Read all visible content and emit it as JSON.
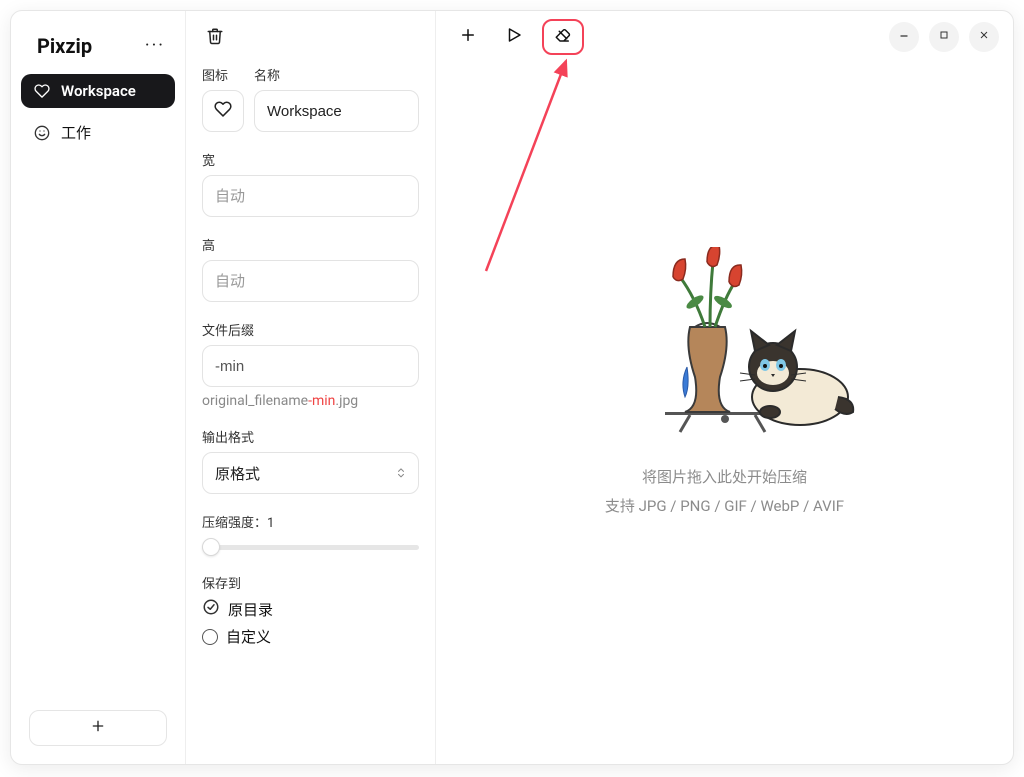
{
  "app": {
    "title": "Pixzip"
  },
  "sidebar": {
    "items": [
      {
        "label": "Workspace",
        "active": true,
        "icon": "heart"
      },
      {
        "label": "工作",
        "active": false,
        "icon": "smile"
      }
    ]
  },
  "panel": {
    "labels": {
      "icon": "图标",
      "name": "名称",
      "width": "宽",
      "height": "高",
      "suffix": "文件后缀",
      "outputFormat": "输出格式",
      "compressionPrefix": "压缩强度：",
      "saveTo": "保存到"
    },
    "values": {
      "name": "Workspace",
      "widthPlaceholder": "自动",
      "heightPlaceholder": "自动",
      "suffix": "-min",
      "hintPrefix": "original_filename",
      "hintAccent": "-min",
      "hintExt": ".jpg",
      "outputFormat": "原格式",
      "compressionLevel": "1"
    },
    "saveOptions": [
      {
        "label": "原目录",
        "checked": true
      },
      {
        "label": "自定义",
        "checked": false
      }
    ]
  },
  "main": {
    "dropLine1": "将图片拖入此处开始压缩",
    "dropLine2": "支持 JPG / PNG / GIF / WebP / AVIF"
  }
}
